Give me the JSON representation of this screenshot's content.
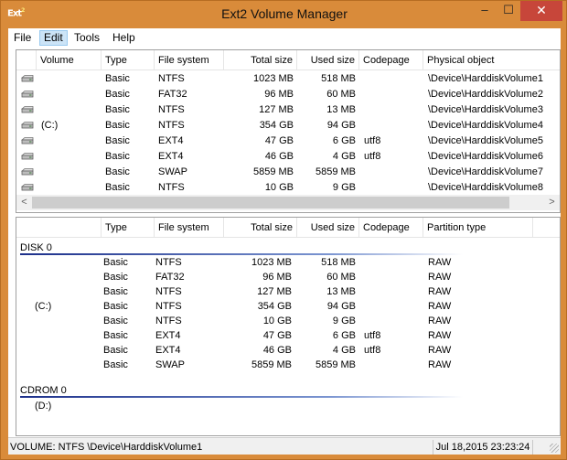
{
  "window": {
    "title": "Ext2 Volume Manager",
    "icon_text": "Ext",
    "icon_sup": "2",
    "min_glyph": "–",
    "max_glyph": "☐",
    "close_glyph": "✕"
  },
  "menu": [
    "File",
    "Edit",
    "Tools",
    "Help"
  ],
  "volumes": {
    "headers": [
      "Volume",
      "Type",
      "File system",
      "Total size",
      "Used size",
      "Codepage",
      "Physical object"
    ],
    "rows": [
      {
        "volume": "",
        "type": "Basic",
        "fs": "NTFS",
        "total": "1023 MB",
        "used": "518 MB",
        "codepage": "",
        "object": "\\Device\\HarddiskVolume1"
      },
      {
        "volume": "",
        "type": "Basic",
        "fs": "FAT32",
        "total": "96 MB",
        "used": "60 MB",
        "codepage": "",
        "object": "\\Device\\HarddiskVolume2"
      },
      {
        "volume": "",
        "type": "Basic",
        "fs": "NTFS",
        "total": "127 MB",
        "used": "13 MB",
        "codepage": "",
        "object": "\\Device\\HarddiskVolume3"
      },
      {
        "volume": "(C:)",
        "type": "Basic",
        "fs": "NTFS",
        "total": "354 GB",
        "used": "94 GB",
        "codepage": "",
        "object": "\\Device\\HarddiskVolume4"
      },
      {
        "volume": "",
        "type": "Basic",
        "fs": "EXT4",
        "total": "47 GB",
        "used": "6 GB",
        "codepage": "utf8",
        "object": "\\Device\\HarddiskVolume5"
      },
      {
        "volume": "",
        "type": "Basic",
        "fs": "EXT4",
        "total": "46 GB",
        "used": "4 GB",
        "codepage": "utf8",
        "object": "\\Device\\HarddiskVolume6"
      },
      {
        "volume": "",
        "type": "Basic",
        "fs": "SWAP",
        "total": "5859 MB",
        "used": "5859 MB",
        "codepage": "",
        "object": "\\Device\\HarddiskVolume7"
      },
      {
        "volume": "",
        "type": "Basic",
        "fs": "NTFS",
        "total": "10 GB",
        "used": "9 GB",
        "codepage": "",
        "object": "\\Device\\HarddiskVolume8"
      }
    ],
    "scroll_left": "<",
    "scroll_right": ">"
  },
  "disks": {
    "headers": [
      "",
      "Type",
      "File system",
      "Total size",
      "Used size",
      "Codepage",
      "Partition type"
    ],
    "disk0": {
      "label": "DISK 0",
      "rows": [
        {
          "volume": "",
          "type": "Basic",
          "fs": "NTFS",
          "total": "1023 MB",
          "used": "518 MB",
          "codepage": "",
          "ptype": "RAW"
        },
        {
          "volume": "",
          "type": "Basic",
          "fs": "FAT32",
          "total": "96 MB",
          "used": "60 MB",
          "codepage": "",
          "ptype": "RAW"
        },
        {
          "volume": "",
          "type": "Basic",
          "fs": "NTFS",
          "total": "127 MB",
          "used": "13 MB",
          "codepage": "",
          "ptype": "RAW"
        },
        {
          "volume": "(C:)",
          "type": "Basic",
          "fs": "NTFS",
          "total": "354 GB",
          "used": "94 GB",
          "codepage": "",
          "ptype": "RAW"
        },
        {
          "volume": "",
          "type": "Basic",
          "fs": "NTFS",
          "total": "10 GB",
          "used": "9 GB",
          "codepage": "",
          "ptype": "RAW"
        },
        {
          "volume": "",
          "type": "Basic",
          "fs": "EXT4",
          "total": "47 GB",
          "used": "6 GB",
          "codepage": "utf8",
          "ptype": "RAW"
        },
        {
          "volume": "",
          "type": "Basic",
          "fs": "EXT4",
          "total": "46 GB",
          "used": "4 GB",
          "codepage": "utf8",
          "ptype": "RAW"
        },
        {
          "volume": "",
          "type": "Basic",
          "fs": "SWAP",
          "total": "5859 MB",
          "used": "5859 MB",
          "codepage": "",
          "ptype": "RAW"
        }
      ]
    },
    "cdrom0": {
      "label": "CDROM 0",
      "rows": [
        {
          "volume": "(D:)"
        }
      ]
    }
  },
  "status": {
    "left": "VOLUME:  NTFS \\Device\\HarddiskVolume1",
    "right": "Jul 18,2015 23:23:24"
  },
  "colors": {
    "frame": "#d98b3a",
    "close_button": "#c7463a",
    "menu_highlight": "#cce4f7",
    "group_line": "#1c2f8a"
  }
}
